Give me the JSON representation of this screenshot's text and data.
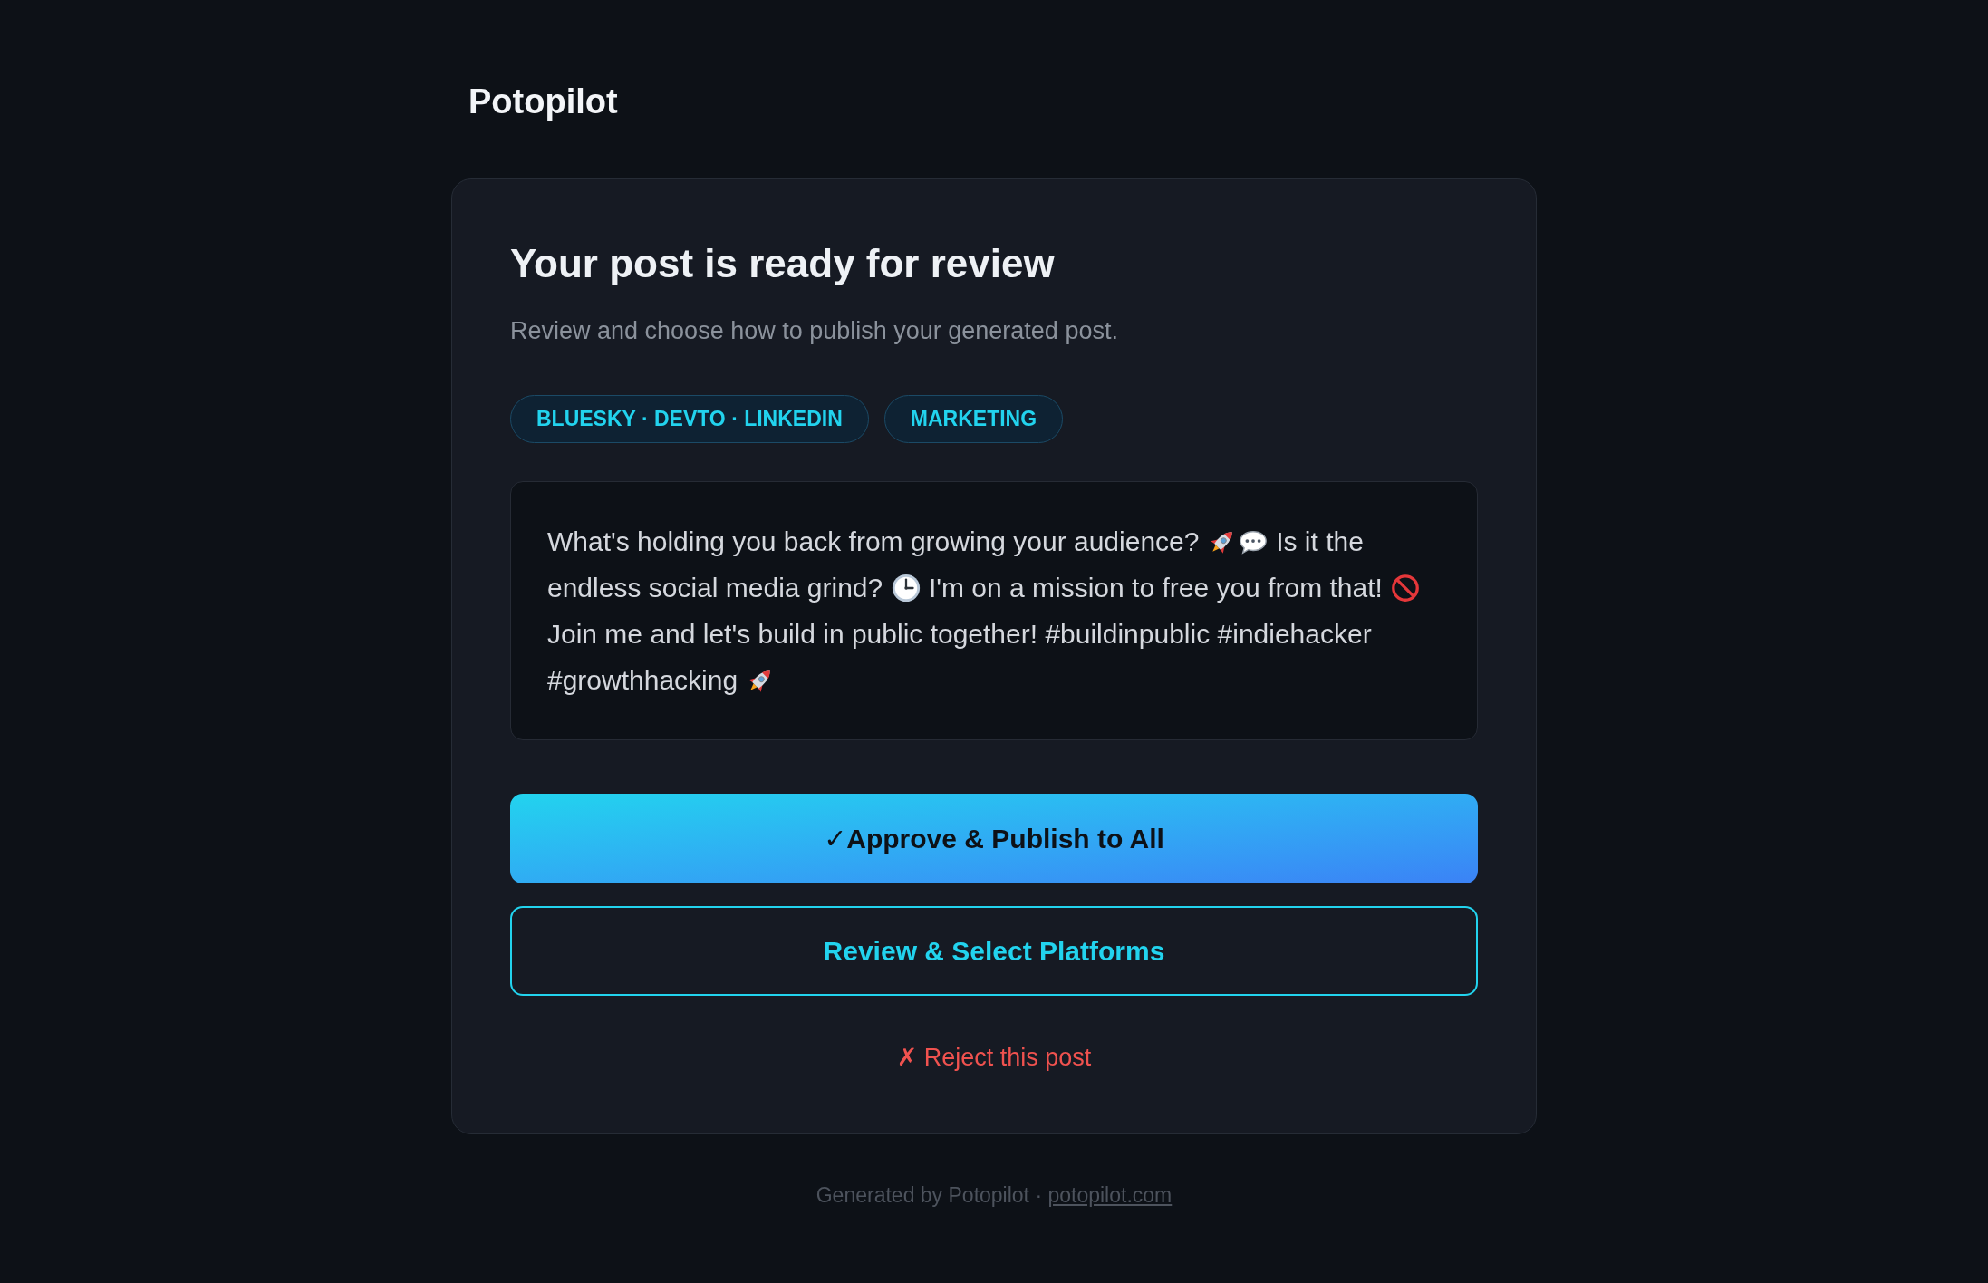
{
  "brand": {
    "name": "Potopilot"
  },
  "review": {
    "title": "Your post is ready for review",
    "subtitle": "Review and choose how to publish your generated post.",
    "tags": [
      {
        "label": "BLUESKY · DEVTO · LINKEDIN"
      },
      {
        "label": "MARKETING"
      }
    ],
    "post": [
      {
        "kind": "text",
        "text": "What's holding you back from growing your audience?"
      },
      {
        "kind": "emoji"
      },
      {
        "kind": "emoji"
      },
      {
        "kind": "text",
        "text": "Is it the endless social media grind?"
      },
      {
        "kind": "emoji"
      },
      {
        "kind": "text",
        "text": "I'm on a mission to free you from that!"
      },
      {
        "kind": "emoji"
      },
      {
        "kind": "text",
        "text": "Join me and let's build in public together! #buildinpublic #indiehacker #growthhacking"
      },
      {
        "kind": "emoji"
      }
    ],
    "actions": [
      {
        "kind": "primary",
        "label": "✓Approve & Publish to All"
      },
      {
        "kind": "outline",
        "label": "Review & Select Platforms"
      },
      {
        "kind": "link",
        "label": "✗ Reject this post"
      }
    ]
  },
  "footer": {
    "text": "Generated by Potopilot ·",
    "link": "potopilot.com"
  }
}
